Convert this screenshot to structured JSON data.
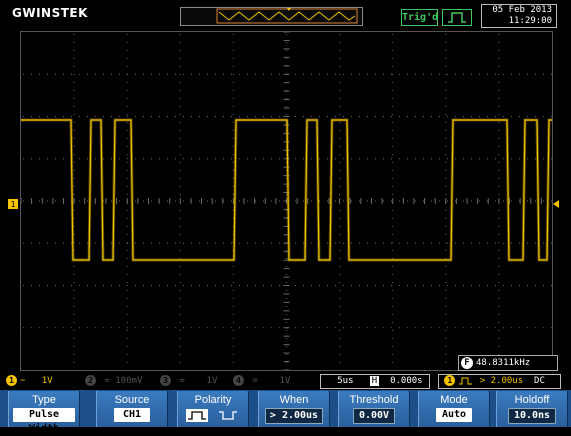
{
  "brand": "GWINSTEK",
  "trigger_status": "Trig'd",
  "date": "05 Feb 2013",
  "time": "11:29:00",
  "frequency": "48.8311kHz",
  "frequency_badge": "F",
  "channels": [
    {
      "num": "1",
      "coupling": "~",
      "scale": "1V",
      "color": "#f3c300"
    },
    {
      "num": "2",
      "coupling": "=",
      "scale": "100mV",
      "color": "#444"
    },
    {
      "num": "3",
      "coupling": "=",
      "scale": "1V",
      "color": "#444"
    },
    {
      "num": "4",
      "coupling": "=",
      "scale": "1V",
      "color": "#444"
    }
  ],
  "timebase": "5us",
  "horizontal_mode_icon": "H",
  "time_offset": "0.000s",
  "trigger_source": "1",
  "trigger_condition": "> 2.00us",
  "trigger_coupling": "DC",
  "ch1_marker": "1",
  "softkeys": [
    {
      "label": "Type",
      "value": "Pulse Width"
    },
    {
      "label": "Source",
      "value": "CH1"
    },
    {
      "label": "Polarity",
      "value": ""
    },
    {
      "label": "When",
      "value": "> 2.00us"
    },
    {
      "label": "Threshold",
      "value": "0.00V"
    },
    {
      "label": "Mode",
      "value": "Auto"
    },
    {
      "label": "Holdoff",
      "value": "10.0ns"
    }
  ],
  "colors": {
    "ch1": "#f3c300",
    "grid": "#555555",
    "softkey_bg": "#2a6ab0",
    "trig_ok": "#3cc95a"
  }
}
